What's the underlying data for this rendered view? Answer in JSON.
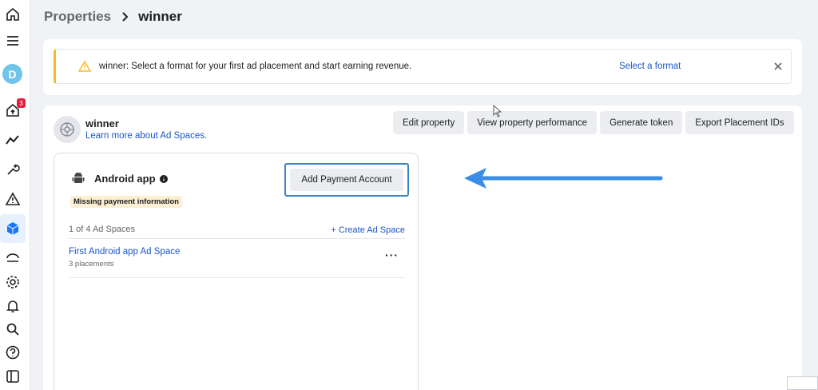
{
  "breadcrumb": {
    "parent": "Properties",
    "current": "winner"
  },
  "sidebar": {
    "avatar_letter": "D",
    "notification_count": "3",
    "items": [
      {
        "icon": "home-icon"
      },
      {
        "icon": "menu-icon"
      },
      {
        "icon": "avatar"
      },
      {
        "icon": "inbox-home-icon"
      },
      {
        "icon": "trend-icon"
      },
      {
        "icon": "wrench-icon"
      },
      {
        "icon": "warning-icon"
      },
      {
        "icon": "cube-icon",
        "active": true
      },
      {
        "icon": "bank-icon"
      },
      {
        "icon": "gear-icon"
      },
      {
        "icon": "bell-icon"
      },
      {
        "icon": "search-icon"
      },
      {
        "icon": "help-icon"
      },
      {
        "icon": "panel-icon"
      }
    ]
  },
  "notice": {
    "message": "winner: Select a format for your first ad placement and start earning revenue.",
    "action": "Select a format"
  },
  "property": {
    "name": "winner",
    "learn_link": "Learn more about Ad Spaces.",
    "actions": [
      "Edit property",
      "View property performance",
      "Generate token",
      "Export Placement IDs"
    ]
  },
  "app": {
    "title": "Android app",
    "status": "Missing payment information",
    "payment_button": "Add Payment Account",
    "count": "1 of 4 Ad Spaces",
    "create": "+ Create Ad Space",
    "ad_space": {
      "name": "First Android app Ad Space",
      "sub": "3 placements",
      "more": "···"
    }
  },
  "colors": {
    "accent": "#1a56c4",
    "warning": "#f7b928",
    "highlight": "#3b82c4",
    "arrow": "#3a8ee6"
  }
}
